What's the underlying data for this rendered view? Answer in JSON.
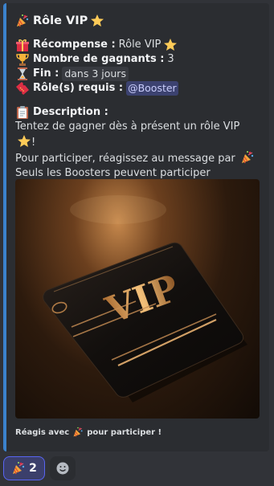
{
  "embed": {
    "title": "Rôle VIP",
    "reward_label": "Récompense :",
    "reward_value": "Rôle VIP",
    "winners_label": "Nombre de gagnants :",
    "winners_value": "3",
    "end_label": "Fin :",
    "end_value": "dans 3 jours",
    "roles_label": "Rôle(s) requis :",
    "roles_value": "@Booster",
    "description_label": "Description :",
    "description_lines": [
      "Tentez de gagner dès à présent un rôle VIP",
      "Pour participer, réagissez au message par",
      "Seuls les Boosters peuvent participer"
    ],
    "image_text": "VIP",
    "footer_before": "Réagis avec",
    "footer_after": "pour participer !"
  },
  "reactions": {
    "main_count": "2"
  },
  "icons": {
    "party": "party-popper-icon",
    "star": "star-icon",
    "gift": "gift-icon",
    "trophy": "trophy-icon",
    "hourglass": "hourglass-icon",
    "ticket": "ticket-icon",
    "clipboard": "clipboard-icon",
    "add_reaction": "add-reaction-icon"
  },
  "colors": {
    "accent": "#3b82cc",
    "embed_bg": "#2b2d31",
    "mention": "#c9cdfb",
    "reaction_border": "#5865f2"
  }
}
